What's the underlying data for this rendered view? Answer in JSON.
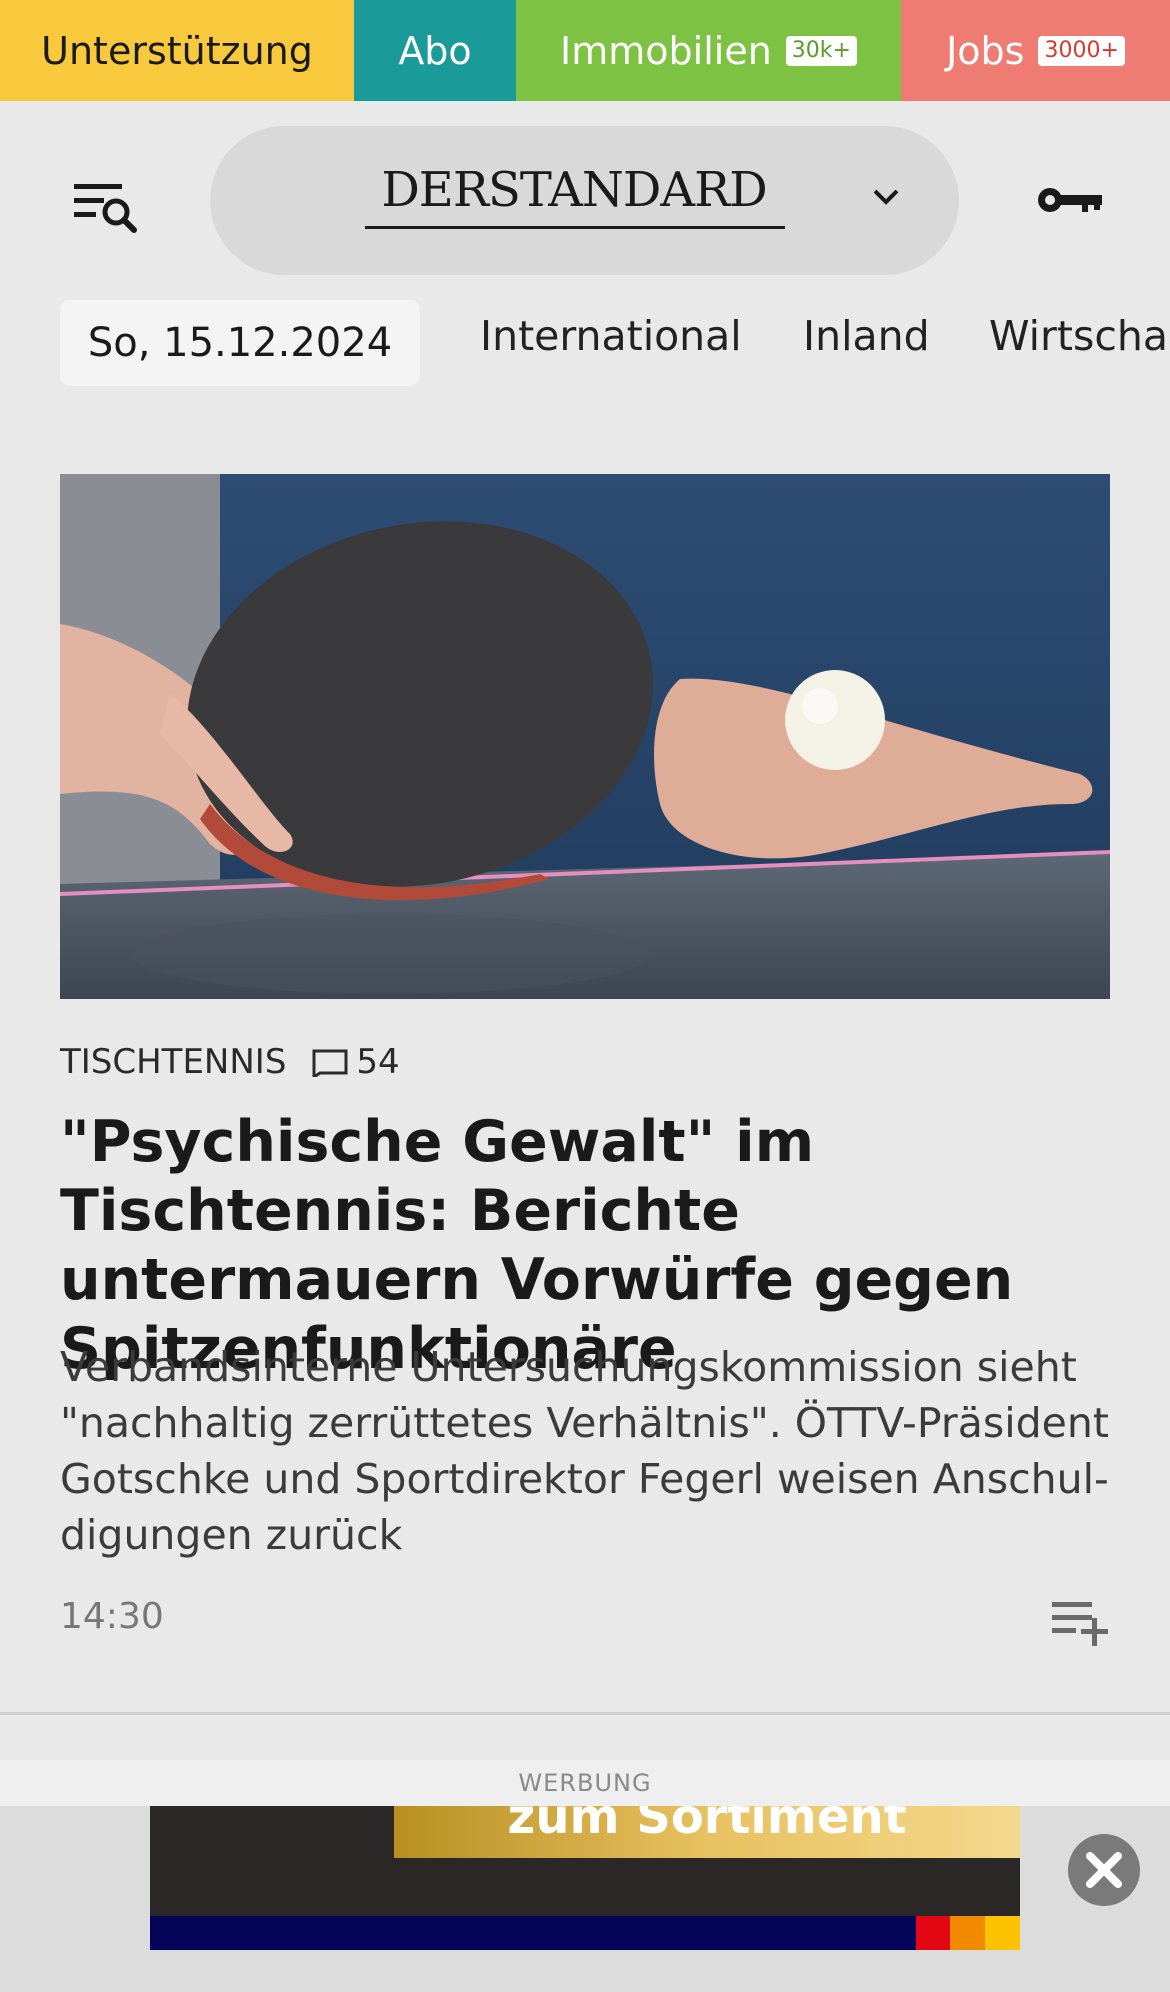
{
  "topbar": {
    "support": "Unterstützung",
    "abo": "Abo",
    "immobilien": "Immobilien",
    "immobilien_badge": "30k+",
    "jobs": "Jobs",
    "jobs_badge": "3000+"
  },
  "header": {
    "logo": "DERSTANDARD",
    "menu_icon": "menu-search-icon",
    "login_icon": "key-icon"
  },
  "nav": {
    "date": "So, 15.12.2024",
    "items": [
      "International",
      "Inland",
      "Wirtscha"
    ]
  },
  "article": {
    "image_alt": "table-tennis-paddle-and-ball-photo",
    "kicker": "TISCHTENNIS",
    "comments": "54",
    "headline": "\"Psychische Gewalt\" im Tischtennis: Berichte untermauern Vorwürfe gegen Spitzenfunktionäre",
    "lead": "Verbandsinterne Untersuchungskommission sieht \"nachhaltig zerrüttetes Verhältnis\". ÖTTV-Präsident Gotschke und Sportdirektor Fegerl weisen Anschul- digungen zurück",
    "time": "14:30"
  },
  "ad": {
    "label": "WERBUNG",
    "cta": "zum Sortiment"
  },
  "colors": {
    "support": "#f8c93c",
    "abo": "#1b9a9a",
    "immobilien": "#7dc242",
    "jobs": "#ee7c73",
    "background": "#e9e9e9"
  }
}
